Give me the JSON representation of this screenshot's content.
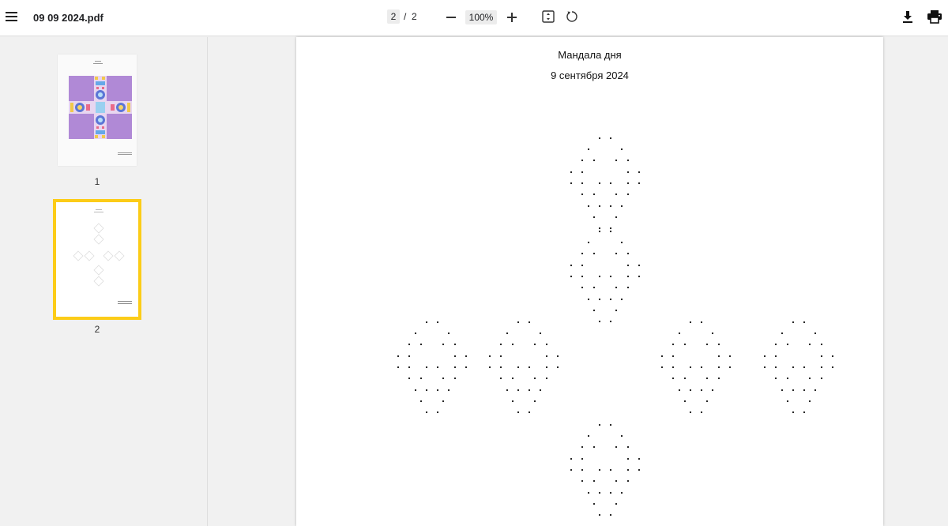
{
  "toolbar": {
    "file_name": "09 09 2024.pdf",
    "current_page": "2",
    "page_separator": "/",
    "total_pages": "2",
    "zoom": "100%",
    "icons": [
      "menu-icon",
      "zoom-out-icon",
      "zoom-in-icon",
      "fit-page-icon",
      "rotate-icon",
      "download-icon",
      "print-icon"
    ]
  },
  "sidebar": {
    "thumbnails": [
      {
        "label": "1",
        "selected": false
      },
      {
        "label": "2",
        "selected": true
      }
    ],
    "selected_color": "#fccc18",
    "thumb1_fill_color": "#b089d6"
  },
  "document": {
    "title": "Мандала дня",
    "date": "9 сентября 2024"
  }
}
